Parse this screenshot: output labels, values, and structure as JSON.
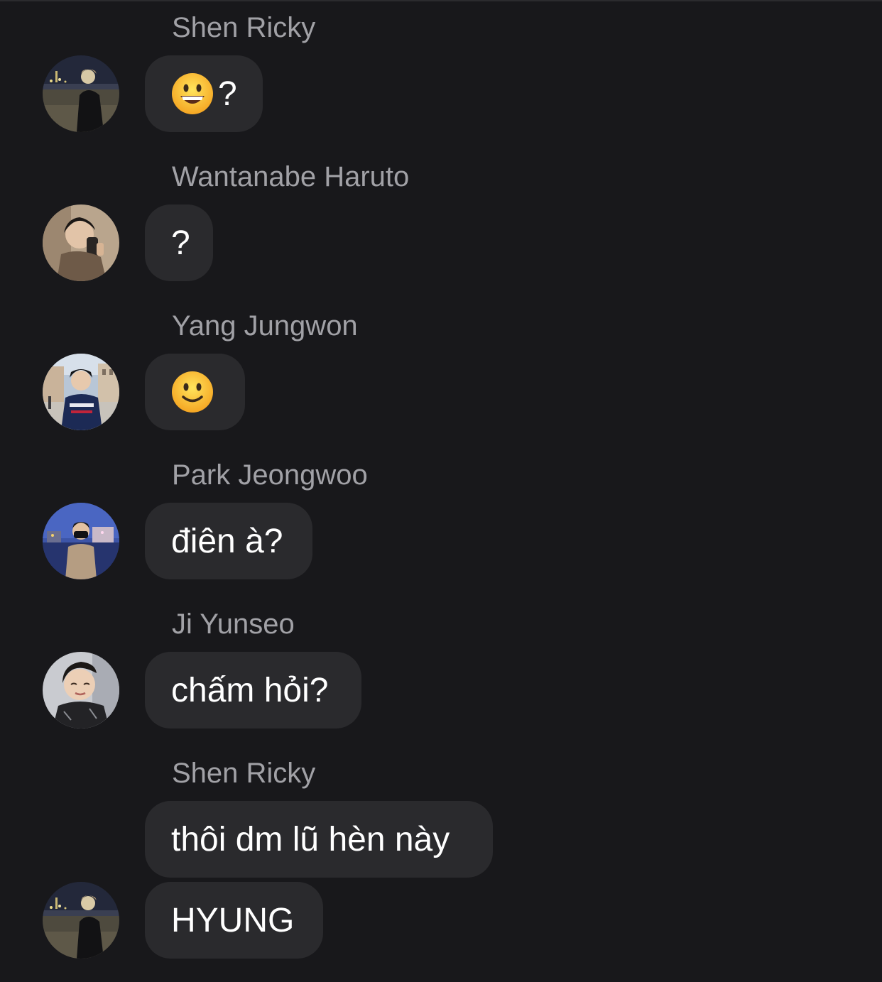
{
  "messages": [
    {
      "sender": "Shen Ricky",
      "avatar_icon": "avatar-night-beach-icon",
      "bubble": {
        "emoji": "grinning-face-icon",
        "text": "?"
      }
    },
    {
      "sender": "Wantanabe Haruto",
      "avatar_icon": "avatar-mirror-selfie-icon",
      "bubble": {
        "text": "?"
      }
    },
    {
      "sender": "Yang Jungwon",
      "avatar_icon": "avatar-city-square-icon",
      "bubble": {
        "emoji": "slightly-smiling-face-icon"
      }
    },
    {
      "sender": "Park Jeongwoo",
      "avatar_icon": "avatar-harbor-evening-icon",
      "bubble": {
        "text": "điên à?"
      }
    },
    {
      "sender": "Ji Yunseo",
      "avatar_icon": "avatar-selfie-icon",
      "bubble": {
        "text": "chấm hỏi?"
      }
    },
    {
      "sender": "Shen Ricky",
      "avatar_icon": "avatar-night-beach-icon",
      "bubbles": [
        {
          "text": "thôi dm lũ hèn này"
        },
        {
          "text": "HYUNG"
        }
      ]
    }
  ],
  "colors": {
    "background": "#18181b",
    "bubble": "#2a2a2d",
    "sender_name": "#a1a1a6",
    "message_text": "#ffffff"
  }
}
